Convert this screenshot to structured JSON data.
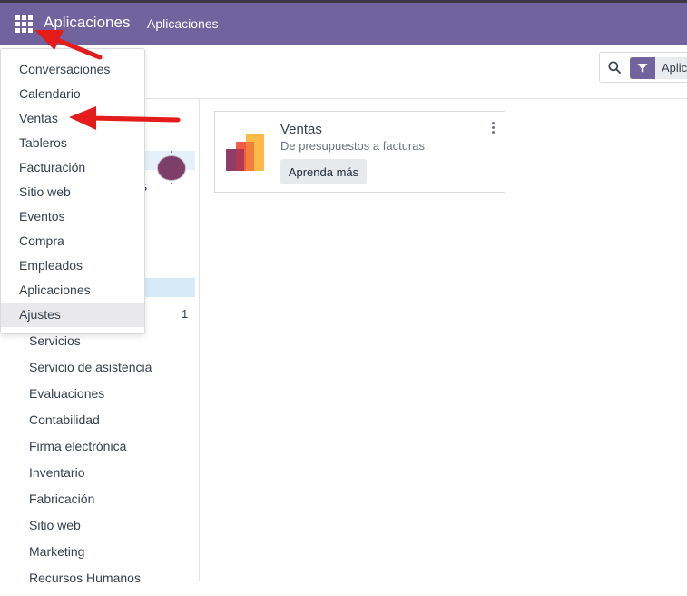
{
  "navbar": {
    "apps_menu_icon": "grid-3x3-icon",
    "brand": "Aplicaciones",
    "menu_item": "Aplicaciones",
    "color": "#71639e"
  },
  "search": {
    "icon": "search-icon",
    "facet_icon": "filter-icon",
    "facet_label": "Aplic"
  },
  "apps_dropdown": {
    "items": [
      {
        "label": "Conversaciones"
      },
      {
        "label": "Calendario"
      },
      {
        "label": "Ventas"
      },
      {
        "label": "Tableros"
      },
      {
        "label": "Facturación"
      },
      {
        "label": "Sitio web"
      },
      {
        "label": "Eventos"
      },
      {
        "label": "Compra"
      },
      {
        "label": "Empleados"
      },
      {
        "label": "Aplicaciones"
      },
      {
        "label": "Ajustes",
        "active": true
      }
    ]
  },
  "sidepanel": {
    "partial_text": "s",
    "chevron": "chevron-down-icon",
    "count": "1",
    "categories": [
      "Servicios",
      "Servicio de asistencia",
      "Evaluaciones",
      "Contabilidad",
      "Firma electrónica",
      "Inventario",
      "Fabricación",
      "Sitio web",
      "Marketing",
      "Recursos Humanos"
    ]
  },
  "app_card": {
    "title": "Ventas",
    "summary": "De presupuestos a facturas",
    "button": "Aprenda más",
    "logo_icon": "sales-app-logo-icon",
    "menu_icon": "kebab-menu-icon"
  },
  "annotations": {
    "color": "#e31b1b",
    "arrows": [
      "arrow-to-apps-menu",
      "arrow-to-ventas"
    ]
  }
}
